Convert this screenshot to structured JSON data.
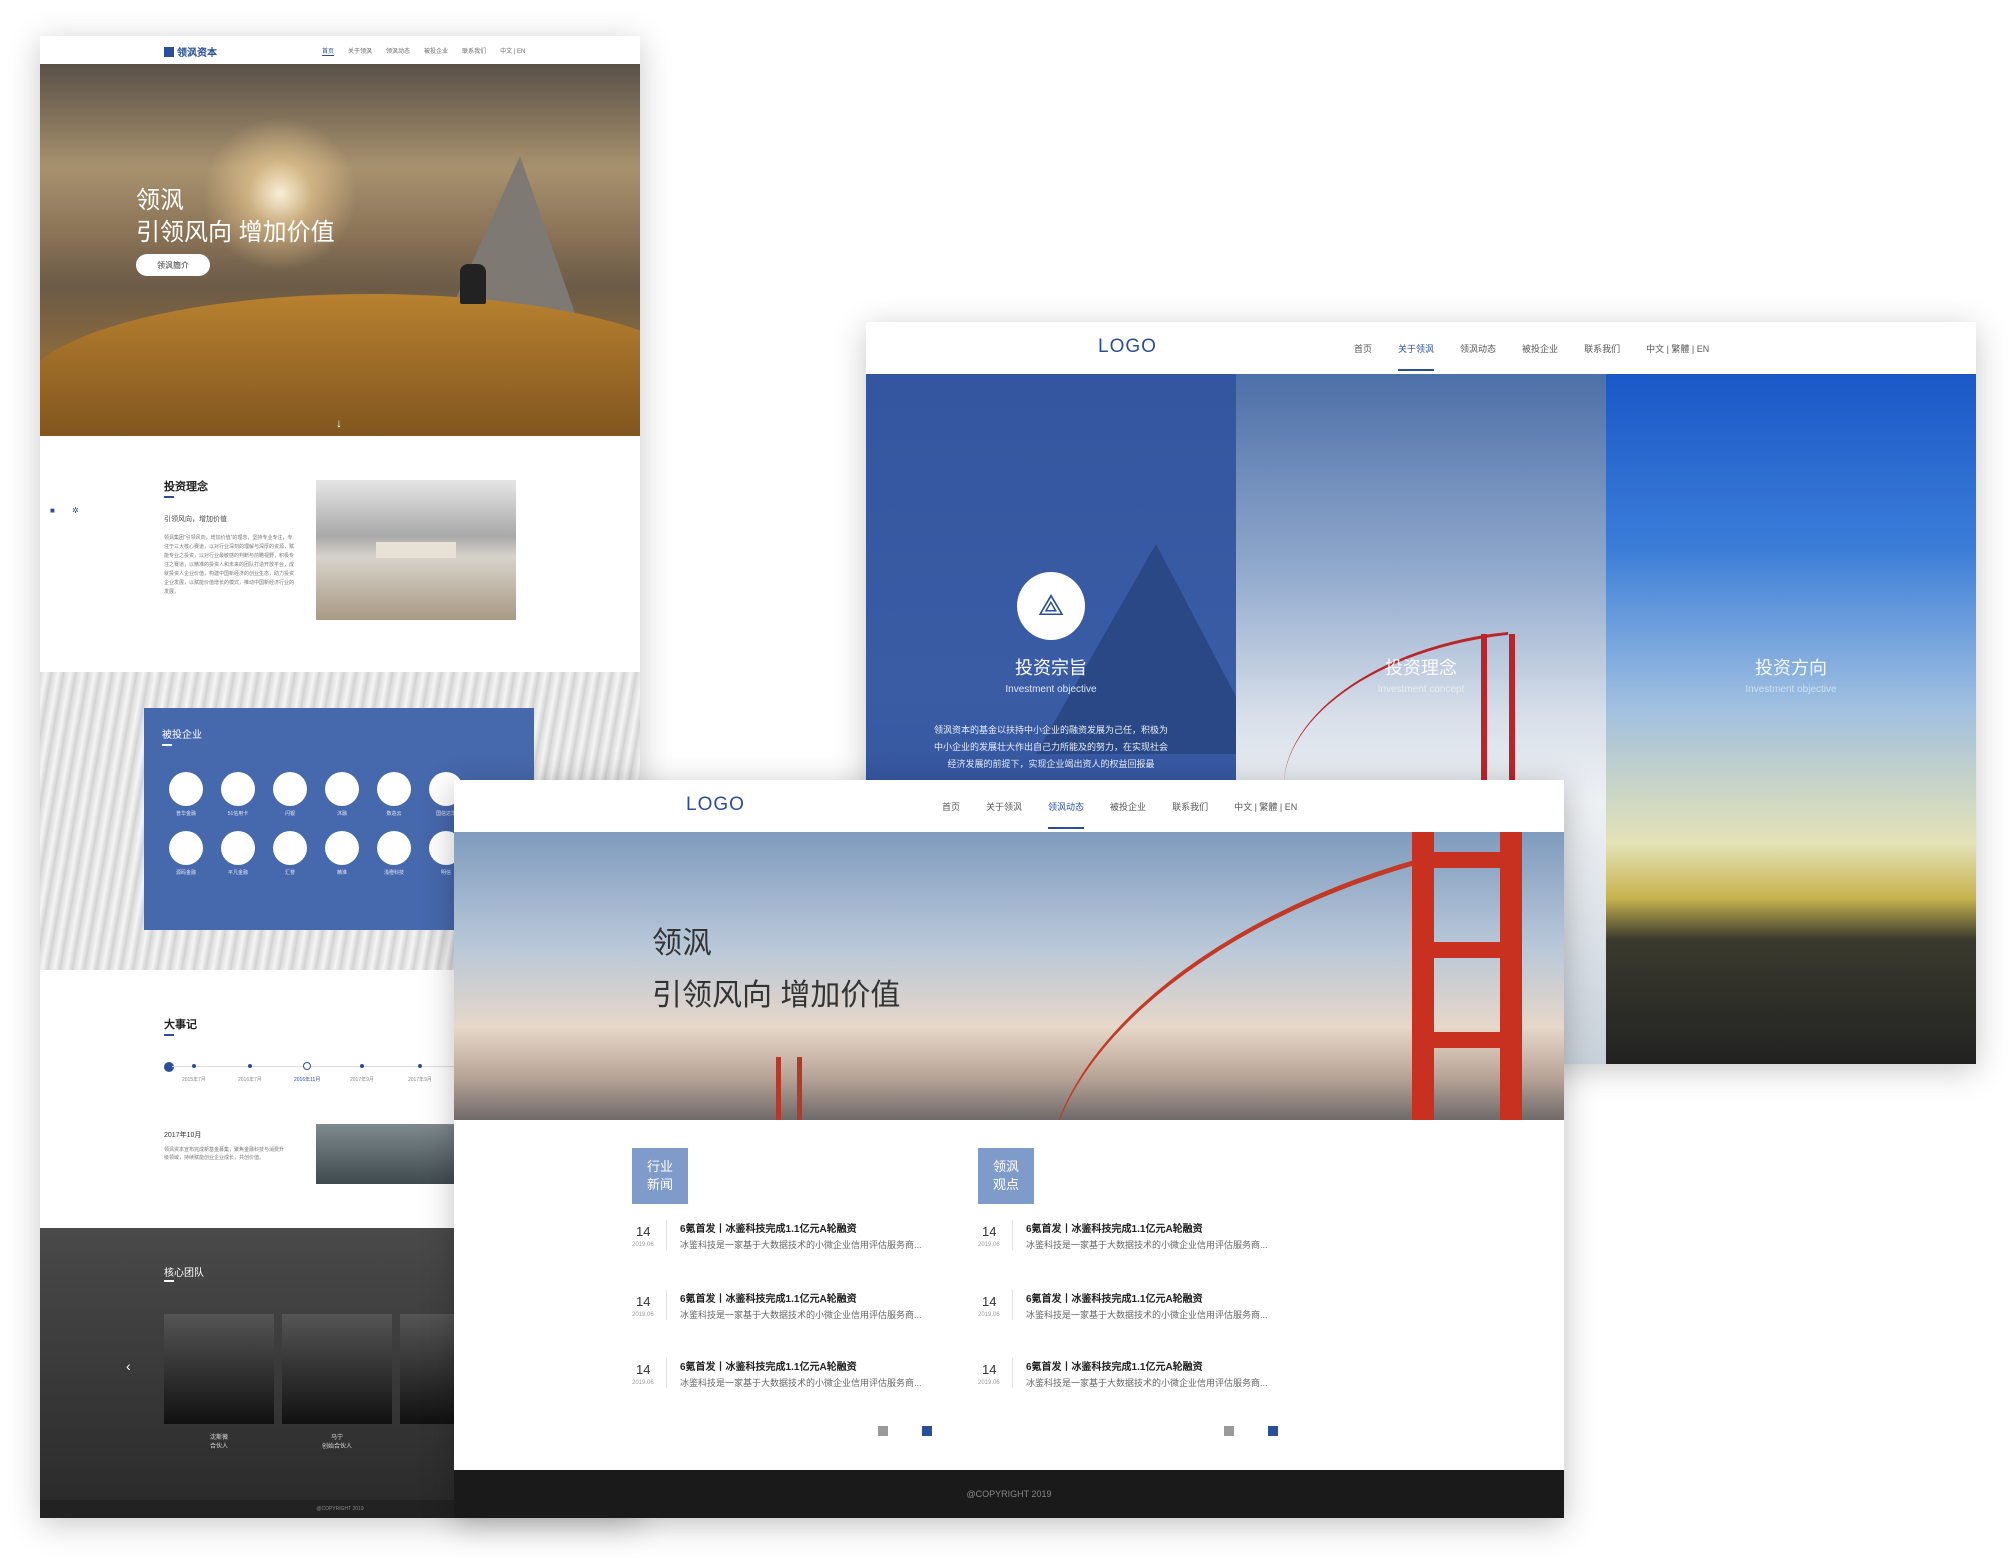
{
  "pageA": {
    "brand": "领沨资本",
    "nav": [
      "首页",
      "关于领沨",
      "领沨动态",
      "被投企业",
      "联系我们",
      "中文 | EN"
    ],
    "hero": {
      "line1": "领沨",
      "line2": "引领风向 增加价值",
      "button": "领沨簡介",
      "down": "↓"
    },
    "invest": {
      "heading": "投资理念",
      "subheading": "引领风向，增加价值",
      "paragraph": "领沨集团“引领风向，增加价值”的理念，坚持专业专注，专注于三大核心赛道，以对行业深刻的理解与深厚的资源，赋能专业之投资，以对行业最敏感的判断与前瞻视野，积极专注之赛道，以精准的投资人和未来的团队打造开放平台，成就投资人企业价值，构建中国新经济的创业生态，助力投资企业发展，以赋能价值增长的模式，推动中国新经济行业的发展。"
    },
    "portfolio": {
      "heading": "被投企业",
      "logos": [
        "普华金融",
        "51信用卡",
        "闪银",
        "沐融",
        "数造云",
        "国信达华",
        "源码金融",
        "平凡金融",
        "汇誉",
        "精准",
        "浅橙科技",
        "明信"
      ]
    },
    "timeline": {
      "heading": "大事记",
      "dates": [
        "2015年7月",
        "2016年7月",
        "2016年11月",
        "2017年9月",
        "2017年9月"
      ],
      "active_index": 2,
      "entry_date": "2017年10月",
      "entry_text": "领沨资本宣布完成新基金募集，聚焦金融科技与消费升级领域，持续赋能创业企业成长，共创价值。"
    },
    "team": {
      "heading": "核心团队",
      "members": [
        {
          "name": "沈斯薇",
          "role": "合伙人"
        },
        {
          "name": "马宁",
          "role": "创始合伙人"
        }
      ]
    },
    "footer": "@COPYRIGHT 2019"
  },
  "pageB": {
    "logo": "LOGO",
    "nav": [
      "首页",
      "关于领沨",
      "领沨动态",
      "被投企业",
      "联系我们",
      "中文 | 繁體 | EN"
    ],
    "active_nav": 1,
    "columns": [
      {
        "title": "投资宗旨",
        "en": "Investment objective",
        "paragraph": "领沨资本的基金以扶持中小企业的融资发展为己任，积极为中小企业的发展壮大作出自己力所能及的努力，在实现社会经济发展的前提下，实现企业竭出资人的权益回报最"
      },
      {
        "title": "投资理念",
        "en": "Investment concept"
      },
      {
        "title": "投资方向",
        "en": "Investment objective"
      }
    ]
  },
  "pageC": {
    "logo": "LOGO",
    "nav": [
      "首页",
      "关于领沨",
      "领沨动态",
      "被投企业",
      "联系我们",
      "中文 | 繁體 | EN"
    ],
    "active_nav": 2,
    "hero": {
      "line1": "领沨",
      "line2": "引领风向 增加价值"
    },
    "news_left": {
      "tag": "行业\n新闻",
      "items": [
        {
          "day": "14",
          "ym": "2019.06",
          "title": "6氪首发丨冰鉴科技完成1.1亿元A轮融资",
          "desc": "冰鉴科技是一家基于大数据技术的小微企业信用评估服务商..."
        },
        {
          "day": "14",
          "ym": "2019.06",
          "title": "6氪首发丨冰鉴科技完成1.1亿元A轮融资",
          "desc": "冰鉴科技是一家基于大数据技术的小微企业信用评估服务商..."
        },
        {
          "day": "14",
          "ym": "2019.06",
          "title": "6氪首发丨冰鉴科技完成1.1亿元A轮融资",
          "desc": "冰鉴科技是一家基于大数据技术的小微企业信用评估服务商..."
        }
      ]
    },
    "news_right": {
      "tag": "领沨\n观点",
      "items": [
        {
          "day": "14",
          "ym": "2019.06",
          "title": "6氪首发丨冰鉴科技完成1.1亿元A轮融资",
          "desc": "冰鉴科技是一家基于大数据技术的小微企业信用评估服务商..."
        },
        {
          "day": "14",
          "ym": "2019.06",
          "title": "6氪首发丨冰鉴科技完成1.1亿元A轮融资",
          "desc": "冰鉴科技是一家基于大数据技术的小微企业信用评估服务商..."
        },
        {
          "day": "14",
          "ym": "2019.06",
          "title": "6氪首发丨冰鉴科技完成1.1亿元A轮融资",
          "desc": "冰鉴科技是一家基于大数据技术的小微企业信用评估服务商..."
        }
      ]
    },
    "footer": "@COPYRIGHT 2019"
  },
  "colors": {
    "accent": "#2a4f9a",
    "panel_blue": "#4668ac",
    "tag_blue": "#7f9bca",
    "bridge_red": "#c8301f",
    "footer_dark": "#1a1a1a"
  }
}
